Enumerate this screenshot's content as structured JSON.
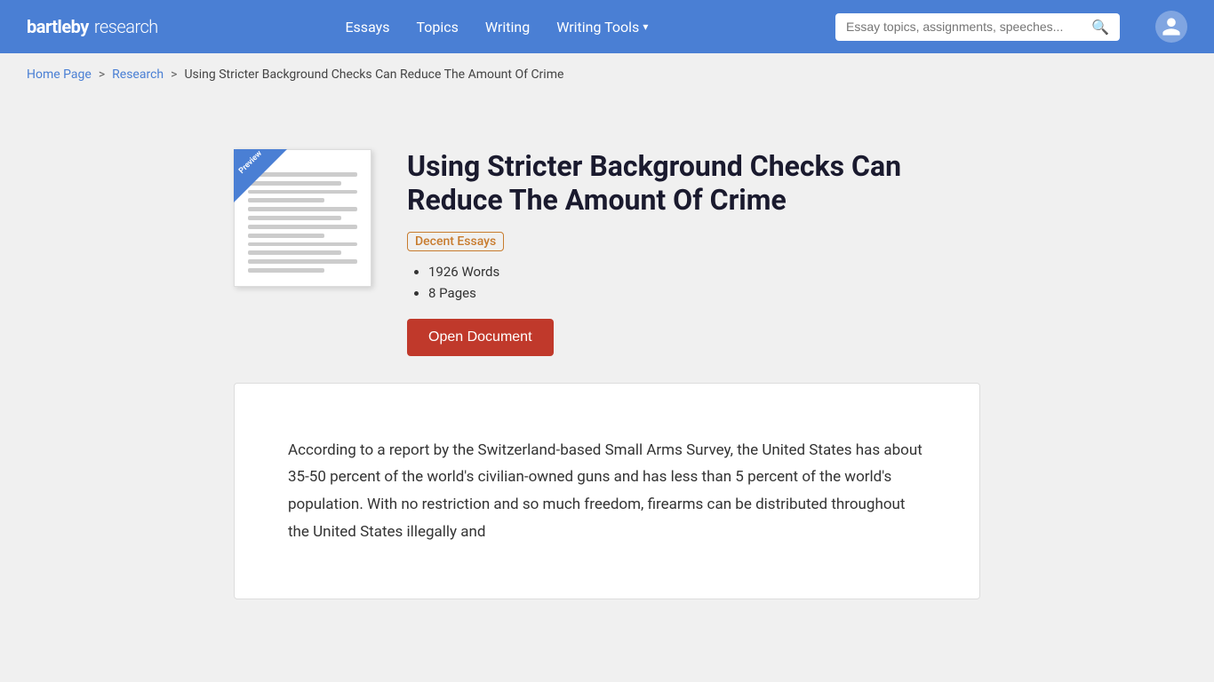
{
  "header": {
    "logo_bartleby": "bartleby",
    "logo_research": "research",
    "nav": {
      "essays": "Essays",
      "topics": "Topics",
      "writing": "Writing",
      "writing_tools": "Writing Tools"
    },
    "search": {
      "placeholder": "Essay topics, assignments, speeches..."
    }
  },
  "breadcrumb": {
    "home": "Home Page",
    "separator1": ">",
    "research": "Research",
    "separator2": ">",
    "current": "Using Stricter Background Checks Can Reduce The Amount Of Crime"
  },
  "essay": {
    "title": "Using Stricter Background Checks Can Reduce The Amount Of Crime",
    "quality_badge": "Decent Essays",
    "words": "1926 Words",
    "pages": "8 Pages",
    "open_document_btn": "Open Document",
    "preview_badge": "Preview",
    "content": "According to a report by the Switzerland-based Small Arms Survey, the United States has about 35-50 percent of the world's civilian-owned guns and has less than 5 percent of the world's population. With no restriction and so much freedom, firearms can be distributed throughout the United States illegally and"
  }
}
